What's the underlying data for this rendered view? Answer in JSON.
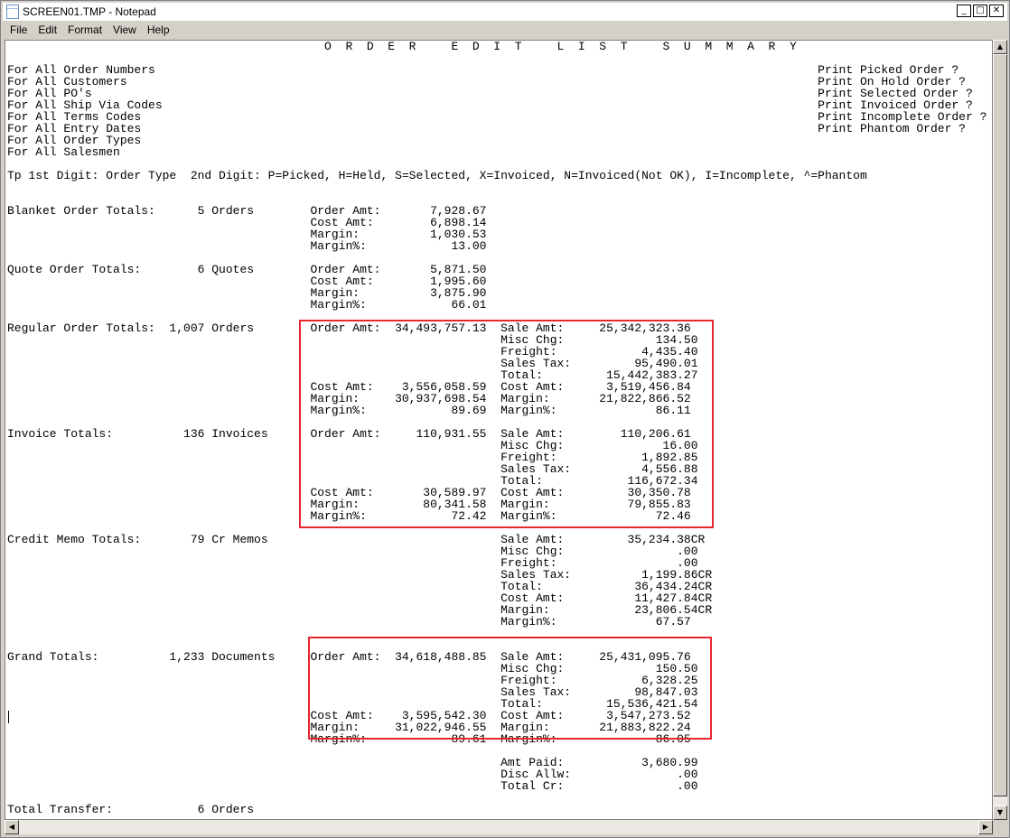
{
  "window": {
    "title": "SCREEN01.TMP - Notepad",
    "controls": {
      "minimize": "_",
      "maximize": "□",
      "close": "✕"
    }
  },
  "menu": [
    "File",
    "Edit",
    "Format",
    "View",
    "Help"
  ],
  "scroll_glyphs": {
    "up": "▲",
    "down": "▼",
    "left": "◀",
    "right": "▶"
  },
  "report_lines": [
    "                                             O  R  D  E  R     E  D  I  T     L  I  S  T     S  U  M  M  A  R  Y",
    "",
    "For All Order Numbers                                                                                              Print Picked Order ?     Y",
    "For All Customers                                                                                                  Print On Hold Order ?    Y",
    "For All PO's                                                                                                       Print Selected Order ?   Y",
    "For All Ship Via Codes                                                                                             Print Invoiced Order ?   Y",
    "For All Terms Codes                                                                                                Print Incomplete Order ? N",
    "For All Entry Dates                                                                                                Print Phantom Order ?    Y",
    "For All Order Types",
    "For All Salesmen",
    "",
    "Tp 1st Digit: Order Type  2nd Digit: P=Picked, H=Held, S=Selected, X=Invoiced, N=Invoiced(Not OK), I=Incomplete, ^=Phantom",
    "",
    "",
    "Blanket Order Totals:      5 Orders        Order Amt:       7,928.67",
    "                                           Cost Amt:        6,898.14",
    "                                           Margin:          1,030.53",
    "                                           Margin%:            13.00",
    "",
    "Quote Order Totals:        6 Quotes        Order Amt:       5,871.50",
    "                                           Cost Amt:        1,995.60",
    "                                           Margin:          3,875.90",
    "                                           Margin%:            66.01",
    "",
    "Regular Order Totals:  1,007 Orders        Order Amt:  34,493,757.13  Sale Amt:     25,342,323.36",
    "                                                                      Misc Chg:             134.50",
    "                                                                      Freight:            4,435.40",
    "                                                                      Sales Tax:         95,490.01",
    "                                                                      Total:         15,442,383.27",
    "                                           Cost Amt:    3,556,058.59  Cost Amt:      3,519,456.84",
    "                                           Margin:     30,937,698.54  Margin:       21,822,866.52",
    "                                           Margin%:            89.69  Margin%:              86.11",
    "",
    "Invoice Totals:          136 Invoices      Order Amt:     110,931.55  Sale Amt:        110,206.61",
    "                                                                      Misc Chg:              16.00",
    "                                                                      Freight:            1,892.85",
    "                                                                      Sales Tax:          4,556.88",
    "                                                                      Total:            116,672.34",
    "                                           Cost Amt:       30,589.97  Cost Amt:         30,350.78",
    "                                           Margin:         80,341.58  Margin:           79,855.83",
    "                                           Margin%:            72.42  Margin%:              72.46",
    "",
    "Credit Memo Totals:       79 Cr Memos                                 Sale Amt:         35,234.38CR",
    "                                                                      Misc Chg:                .00",
    "                                                                      Freight:                 .00",
    "                                                                      Sales Tax:          1,199.86CR",
    "                                                                      Total:             36,434.24CR",
    "                                                                      Cost Amt:          11,427.84CR",
    "                                                                      Margin:            23,806.54CR",
    "                                                                      Margin%:              67.57",
    "",
    "",
    "Grand Totals:          1,233 Documents     Order Amt:  34,618,488.85  Sale Amt:     25,431,095.76",
    "                                                                      Misc Chg:             150.50",
    "                                                                      Freight:            6,328.25",
    "                                                                      Sales Tax:         98,847.03",
    "                                                                      Total:         15,536,421.54",
    "                                           Cost Amt:    3,595,542.30  Cost Amt:      3,547,273.52",
    "                                           Margin:     31,022,946.55  Margin:       21,883,822.24",
    "                                           Margin%:            89.61  Margin%:              86.05",
    "",
    "                                                                      Amt Paid:           3,680.99",
    "                                                                      Disc Allw:               .00",
    "                                                                      Total Cr:                .00",
    "",
    "Total Transfer:            6 Orders"
  ],
  "highlight_color": "#e8262f"
}
